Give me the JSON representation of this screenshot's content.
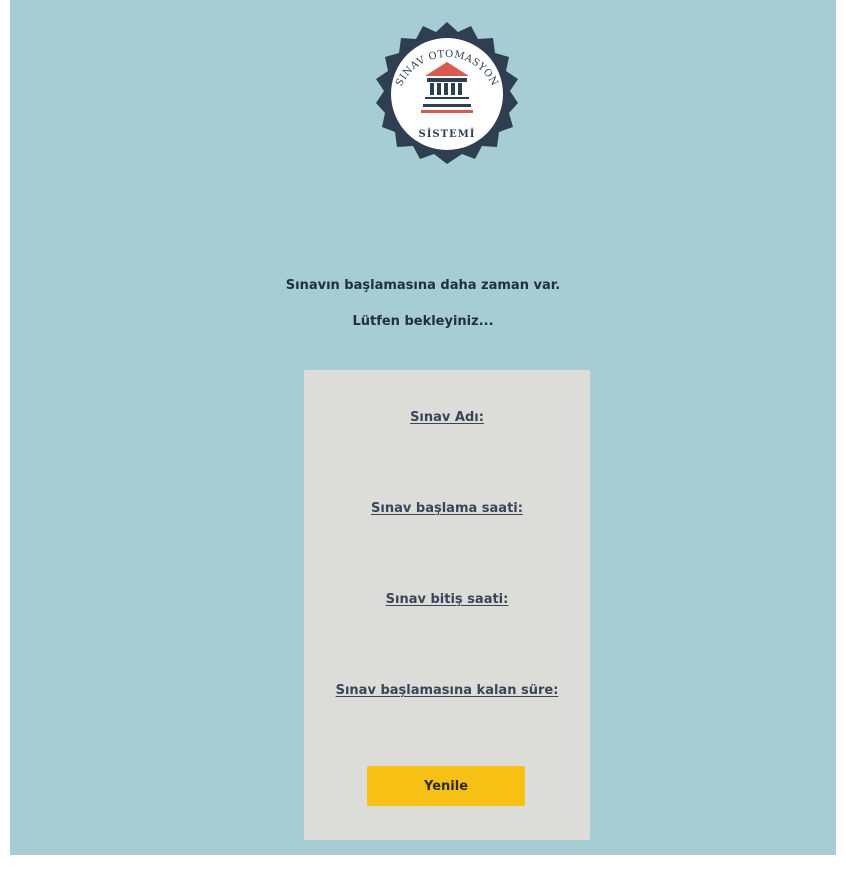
{
  "logo": {
    "top_text": "SINAV OTOMASYON",
    "bottom_text": "SİSTEMİ"
  },
  "messages": {
    "line1": "Sınavın başlamasına daha zaman var.",
    "line2": "Lütfen bekleyiniz..."
  },
  "exam_card": {
    "name_label": "Sınav Adı:",
    "start_label": "Sınav başlama saati:",
    "end_label": "Sınav bitiş saati:",
    "remaining_label": "Sınav başlamasına kalan süre:",
    "refresh_button": "Yenile"
  },
  "colors": {
    "background": "#a6cdd4",
    "card": "#dcdcd8",
    "button": "#f6c015",
    "badge_dark": "#2f3f52",
    "building_red": "#d95a4f"
  },
  "icons": {
    "logo": "courthouse-seal-icon"
  }
}
